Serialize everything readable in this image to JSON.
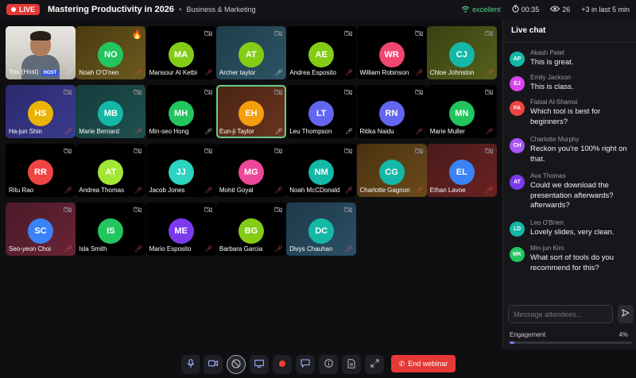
{
  "header": {
    "live_label": "LIVE",
    "title": "Mastering Productivity in 2026",
    "category": "Business & Marketing",
    "connection": "excellent",
    "timer": "00:35",
    "viewers": "26",
    "recent": "+3 in last 5 min"
  },
  "self_tile": {
    "name": "You (Host)",
    "badge": "HOST"
  },
  "participants": [
    {
      "initials": "NO",
      "name": "Noah O'O'nen",
      "color": "#22c55e",
      "bg": "linear-gradient(135deg,#4a3a10,#6b5a1e)"
    },
    {
      "initials": "MA",
      "name": "Mansour Al Ketbi",
      "color": "#84cc16",
      "bg": "#000"
    },
    {
      "initials": "AT",
      "name": "Archer taylor",
      "color": "#84cc16",
      "bg": "linear-gradient(135deg,#1f3d4a,#2c5566)"
    },
    {
      "initials": "AE",
      "name": "Andrea Esposito",
      "color": "#84cc16",
      "bg": "#000"
    },
    {
      "initials": "WR",
      "name": "William Robinson",
      "color": "#ef476f",
      "bg": "#000"
    },
    {
      "initials": "CJ",
      "name": "Chloe Johnston",
      "color": "#14b8a6",
      "bg": "linear-gradient(135deg,#3b4012,#55611c)"
    },
    {
      "initials": "HS",
      "name": "Ha-jun Shin",
      "color": "#eab308",
      "bg": "linear-gradient(135deg,#2a2a6e,#3b3b8f)"
    },
    {
      "initials": "MB",
      "name": "Marie Bernard",
      "color": "#14b8a6",
      "bg": "linear-gradient(135deg,#173c3c,#1f5050)"
    },
    {
      "initials": "MH",
      "name": "Min-seo Hong",
      "color": "#22c55e",
      "bg": "#000"
    },
    {
      "initials": "EH",
      "name": "Eun-ji Taylor",
      "color": "#f59e0b",
      "bg": "linear-gradient(135deg,#4a2414,#6a3420)"
    },
    {
      "initials": "LT",
      "name": "Leu Thompson",
      "color": "#6366f1",
      "bg": "#000"
    },
    {
      "initials": "RN",
      "name": "Ritika Naidu",
      "color": "#6366f1",
      "bg": "#000"
    },
    {
      "initials": "MN",
      "name": "Marie Muller",
      "color": "#22c55e",
      "bg": "#000"
    },
    {
      "initials": "RR",
      "name": "Ritu Rao",
      "color": "#ef4444",
      "bg": "#000"
    },
    {
      "initials": "AT",
      "name": "Andrea Thomas",
      "color": "#a3e635",
      "bg": "#000"
    },
    {
      "initials": "JJ",
      "name": "Jacob Jones",
      "color": "#2dd4bf",
      "bg": "#000"
    },
    {
      "initials": "MG",
      "name": "Mohit Goyal",
      "color": "#ec4899",
      "bg": "#000"
    },
    {
      "initials": "NM",
      "name": "Noah McCDonald",
      "color": "#14b8a6",
      "bg": "#000"
    },
    {
      "initials": "CG",
      "name": "Charlotte Gagnon",
      "color": "#14b8a6",
      "bg": "linear-gradient(135deg,#4a3210,#6a4a1c)"
    },
    {
      "initials": "EL",
      "name": "Ethan Lavoe",
      "color": "#3b82f6",
      "bg": "linear-gradient(135deg,#4a1a1a,#6a2222)"
    },
    {
      "initials": "SC",
      "name": "Seo-yeon Choi",
      "color": "#3b82f6",
      "bg": "linear-gradient(135deg,#4a1a28,#6a2436)"
    },
    {
      "initials": "IS",
      "name": "Isla Smith",
      "color": "#22c55e",
      "bg": "#000"
    },
    {
      "initials": "ME",
      "name": "Mario Esposito",
      "color": "#7c3aed",
      "bg": "#000"
    },
    {
      "initials": "BG",
      "name": "Barbara Garcia",
      "color": "#84cc16",
      "bg": "#000"
    },
    {
      "initials": "DC",
      "name": "Divys Chauhan",
      "color": "#14b8a6",
      "bg": "linear-gradient(135deg,#1e3a4a,#2a5064)"
    }
  ],
  "chat": {
    "title": "Live chat",
    "messages": [
      {
        "initials": "AP",
        "name": "Akash Patel",
        "text": "This is great.",
        "color": "#14b8a6"
      },
      {
        "initials": "EJ",
        "name": "Emily Jackson",
        "text": "This is class.",
        "color": "#d946ef"
      },
      {
        "initials": "FA",
        "name": "Faisal Al-Shamsi",
        "text": "Which tool is best for beginners?",
        "color": "#ef4444"
      },
      {
        "initials": "CH",
        "name": "Charlotte Murphy",
        "text": "Reckon you're 100% right on that.",
        "color": "#a855f7"
      },
      {
        "initials": "AT",
        "name": "Ava Thomas",
        "text": "Could we download the presentation afterwards? afterwards?",
        "color": "#7c3aed"
      },
      {
        "initials": "LD",
        "name": "Leo O'Brien",
        "text": "Lovely slides, very clean.",
        "color": "#14b8a6"
      },
      {
        "initials": "MK",
        "name": "Min-jun Kim",
        "text": "What sort of tools do you recommend for this?",
        "color": "#22c55e"
      }
    ],
    "input_placeholder": "Message attendees...",
    "engagement_label": "Engagement",
    "engagement_value": "4%",
    "engagement_fraction": 0.04
  },
  "toolbar": {
    "end_label": "End webinar",
    "buttons": [
      "mic-icon",
      "camera-icon",
      "camera-off-icon",
      "screen-share-icon",
      "record-icon",
      "chat-icon",
      "info-icon",
      "document-icon",
      "fullscreen-icon"
    ]
  }
}
